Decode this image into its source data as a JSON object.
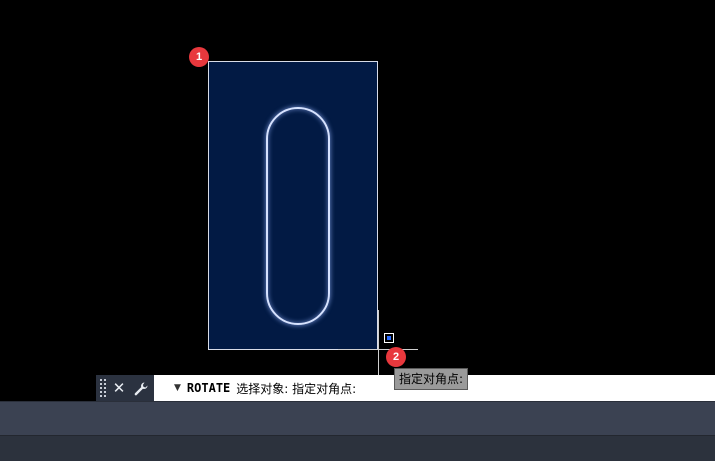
{
  "drawing": {
    "badges": [
      "1",
      "2"
    ]
  },
  "tooltip": {
    "text": "指定对角点:"
  },
  "command_line": {
    "command": "ROTATE",
    "prompt": "选择对象: 指定对角点:"
  },
  "icons": {
    "grip": "grip-handle-icon",
    "close": "close-icon",
    "customize": "wrench-icon",
    "history": "caret-down-icon"
  },
  "colors": {
    "canvas": "#000000",
    "selection_fill": "#021a44",
    "badge": "#e8383d",
    "shape_stroke": "#d6e2ff"
  }
}
